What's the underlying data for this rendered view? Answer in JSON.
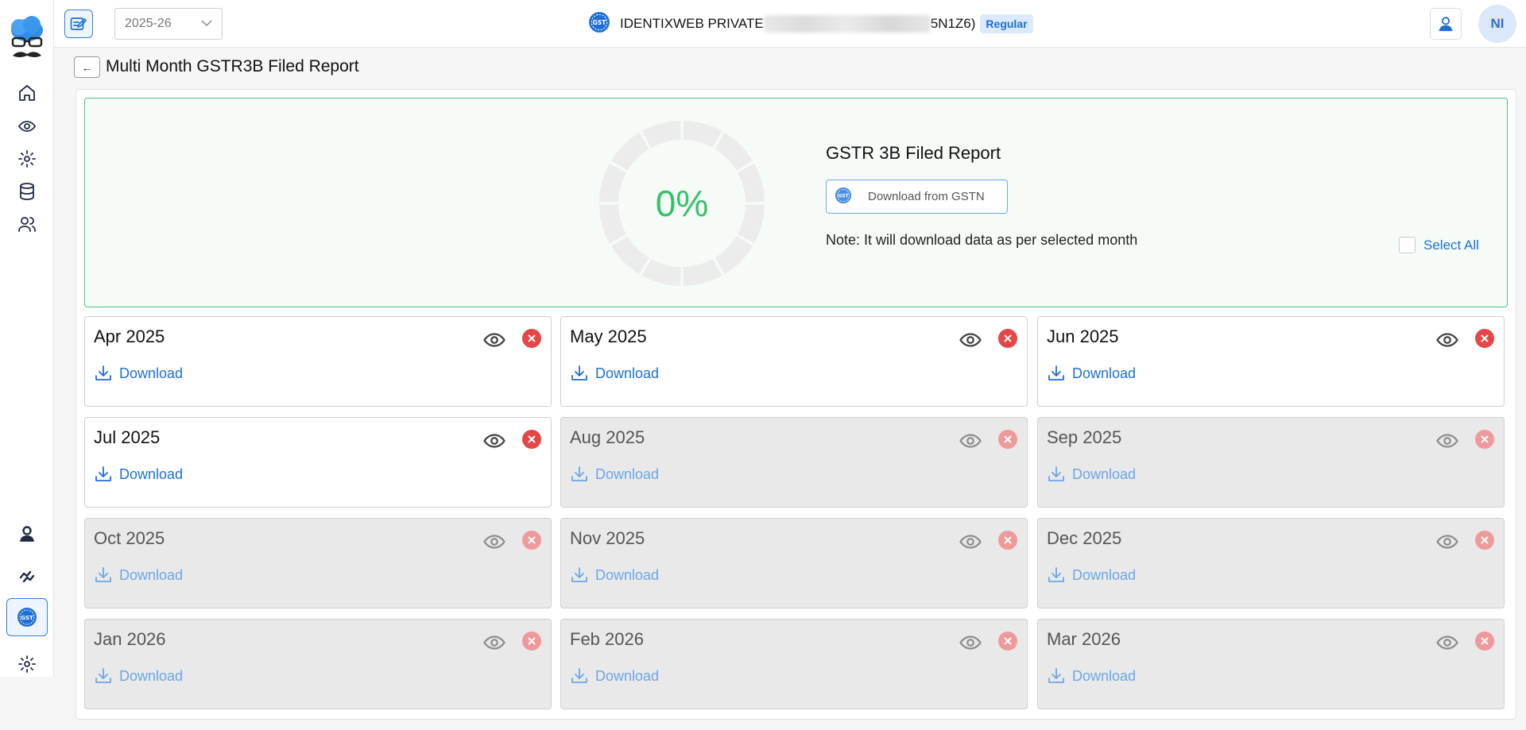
{
  "topbar": {
    "year": "2025-26",
    "company_name": "IDENTIXWEB PRIVATE",
    "company_gstin_suffix": "5N1Z6)",
    "registration_type": "Regular",
    "avatar_initials": "NI"
  },
  "page": {
    "title": "Multi Month GSTR3B Filed Report"
  },
  "summary": {
    "progress_label": "0%",
    "progress_value": 0,
    "title": "GSTR 3B Filed Report",
    "download_button": "Download from GSTN",
    "note": "Note: It will download data as per selected month",
    "select_all": "Select All"
  },
  "months": [
    {
      "name": "Apr 2025",
      "download": "Download",
      "enabled": true
    },
    {
      "name": "May 2025",
      "download": "Download",
      "enabled": true
    },
    {
      "name": "Jun 2025",
      "download": "Download",
      "enabled": true
    },
    {
      "name": "Jul 2025",
      "download": "Download",
      "enabled": true
    },
    {
      "name": "Aug 2025",
      "download": "Download",
      "enabled": false
    },
    {
      "name": "Sep 2025",
      "download": "Download",
      "enabled": false
    },
    {
      "name": "Oct 2025",
      "download": "Download",
      "enabled": false
    },
    {
      "name": "Nov 2025",
      "download": "Download",
      "enabled": false
    },
    {
      "name": "Dec 2025",
      "download": "Download",
      "enabled": false
    },
    {
      "name": "Jan 2026",
      "download": "Download",
      "enabled": false
    },
    {
      "name": "Feb 2026",
      "download": "Download",
      "enabled": false
    },
    {
      "name": "Mar 2026",
      "download": "Download",
      "enabled": false
    }
  ],
  "colors": {
    "accent": "#1d6fd6",
    "success": "#35c169",
    "danger": "#e54747",
    "summary_border": "#4cbf86"
  },
  "icons": {
    "sidebar": [
      "home-icon",
      "eye-icon",
      "gear-icon",
      "database-icon",
      "users-icon",
      "user-support-icon",
      "sync-icon",
      "gst-icon",
      "settings-icon"
    ]
  }
}
